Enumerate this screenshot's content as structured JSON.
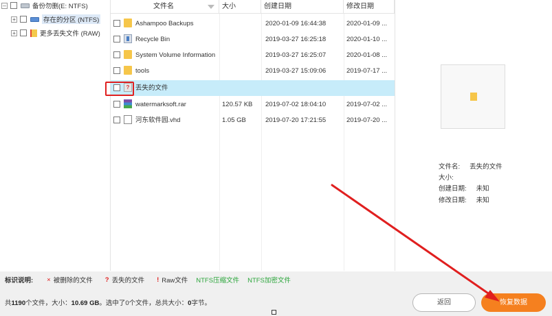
{
  "tree": {
    "items": [
      {
        "label": "备份勿删(E: NTFS)",
        "expander": "–"
      },
      {
        "label": "存在的分区 (NTFS)",
        "expander": "+"
      },
      {
        "label": "更多丢失文件 (RAW)",
        "expander": "+"
      }
    ]
  },
  "list": {
    "columns": {
      "name": "文件名",
      "size": "大小",
      "created": "创建日期",
      "modified": "修改日期"
    },
    "rows": [
      {
        "name": "Ashampoo Backups",
        "size": "",
        "created": "2020-01-09 16:44:38",
        "modified": "2020-01-09 ..."
      },
      {
        "name": "Recycle Bin",
        "size": "",
        "created": "2019-03-27 16:25:18",
        "modified": "2020-01-10 ..."
      },
      {
        "name": "System Volume Information",
        "size": "",
        "created": "2019-03-27 16:25:07",
        "modified": "2020-01-08 ..."
      },
      {
        "name": "tools",
        "size": "",
        "created": "2019-03-27 15:09:06",
        "modified": "2019-07-17 ..."
      },
      {
        "name": "丢失的文件",
        "size": "",
        "created": "",
        "modified": ""
      },
      {
        "name": "watermarksoft.rar",
        "size": "120.57 KB",
        "created": "2019-07-02 18:04:10",
        "modified": "2019-07-02 ..."
      },
      {
        "name": "河东软件园.vhd",
        "size": "1.05 GB",
        "created": "2019-07-20 17:21:55",
        "modified": "2019-07-20 ..."
      }
    ],
    "unknown_badge": "?"
  },
  "preview": {
    "filename_label": "文件名:",
    "filename_value": "丢失的文件",
    "size_label": "大小:",
    "created_label": "创建日期:",
    "created_value": "未知",
    "modified_label": "修改日期:",
    "modified_value": "未知"
  },
  "legend": {
    "title": "标识说明:",
    "deleted_mark": "×",
    "deleted": "被删除的文件",
    "lost_mark": "?",
    "lost": "丢失的文件",
    "raw_mark": "!",
    "raw": "Raw文件",
    "ntfs_compressed": "NTFS压缩文件",
    "ntfs_encrypted": "NTFS加密文件"
  },
  "status": {
    "prefix": "共",
    "file_count": "1190",
    "files_size_label": "个文件，大小：",
    "total_size": "10.69 GB",
    "selected_prefix": "。选中了",
    "selected_count": "0",
    "selected_suffix": "个文件，总共大小：",
    "selected_bytes": "0",
    "bytes_suffix": "字节。"
  },
  "buttons": {
    "back": "返回",
    "recover": "恢复数据"
  },
  "colors": {
    "accent": "#f5801f",
    "selected_row": "#c7ecfa",
    "annotation": "#e01f1f",
    "ntfs_green": "#2aa53a"
  }
}
